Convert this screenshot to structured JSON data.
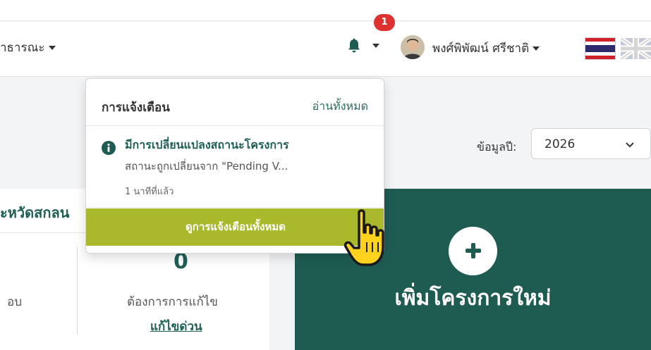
{
  "navbar": {
    "left_menu_label": "าธารณะ",
    "notification_count": "1",
    "user_name": "พงศ์พิพัฒน์ ศรีชาติ"
  },
  "notifications": {
    "title": "การแจ้งเตือน",
    "read_all": "อ่านทั้งหมด",
    "items": [
      {
        "title": "มีการเปลี่ยนแปลงสถานะโครงการ",
        "description": "สถานะถูกเปลี่ยนจาก \"Pending V...",
        "time": "1 นาทีที่แล้ว"
      }
    ],
    "view_all": "ดูการแจ้งเตือนทั้งหมด"
  },
  "filter": {
    "year_label": "ข้อมูลปี:",
    "year_value": "2026"
  },
  "card_left": {
    "title": "ะหวัดสกลน",
    "stat_left_label": "อบ",
    "stat_value": "0",
    "stat_label": "ต้องการการแก้ไข",
    "stat_link": "แก้ไขด่วน"
  },
  "card_new": {
    "label": "เพิ่มโครงการใหม่"
  },
  "colors": {
    "brand_green": "#1e5c52",
    "accent_olive": "#a9b92b",
    "badge_red": "#e03131"
  },
  "icons": [
    "bell-icon",
    "info-icon",
    "chevron-down-icon",
    "plus-icon",
    "hand-cursor-icon",
    "thai-flag-icon",
    "uk-flag-icon"
  ]
}
